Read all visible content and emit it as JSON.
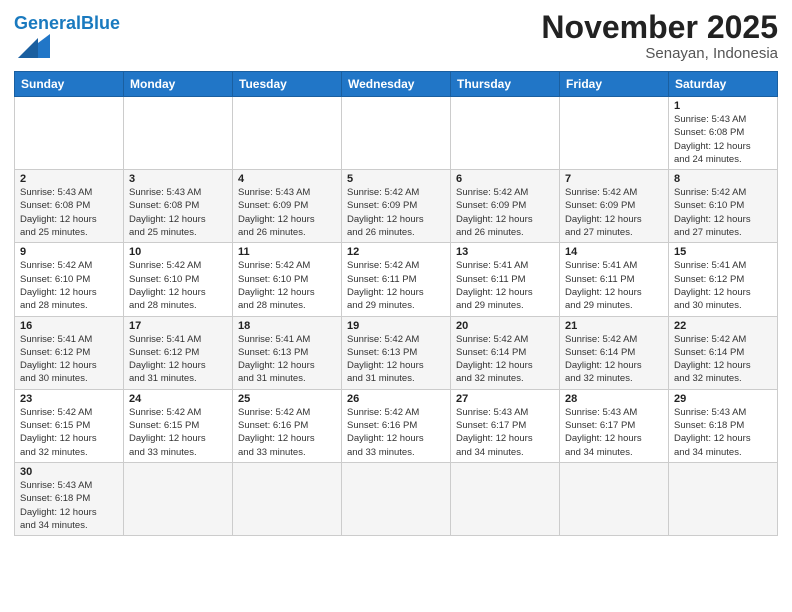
{
  "header": {
    "logo_general": "General",
    "logo_blue": "Blue",
    "month_title": "November 2025",
    "subtitle": "Senayan, Indonesia"
  },
  "weekdays": [
    "Sunday",
    "Monday",
    "Tuesday",
    "Wednesday",
    "Thursday",
    "Friday",
    "Saturday"
  ],
  "weeks": [
    [
      {
        "day": "",
        "info": ""
      },
      {
        "day": "",
        "info": ""
      },
      {
        "day": "",
        "info": ""
      },
      {
        "day": "",
        "info": ""
      },
      {
        "day": "",
        "info": ""
      },
      {
        "day": "",
        "info": ""
      },
      {
        "day": "1",
        "info": "Sunrise: 5:43 AM\nSunset: 6:08 PM\nDaylight: 12 hours\nand 24 minutes."
      }
    ],
    [
      {
        "day": "2",
        "info": "Sunrise: 5:43 AM\nSunset: 6:08 PM\nDaylight: 12 hours\nand 25 minutes."
      },
      {
        "day": "3",
        "info": "Sunrise: 5:43 AM\nSunset: 6:08 PM\nDaylight: 12 hours\nand 25 minutes."
      },
      {
        "day": "4",
        "info": "Sunrise: 5:43 AM\nSunset: 6:09 PM\nDaylight: 12 hours\nand 26 minutes."
      },
      {
        "day": "5",
        "info": "Sunrise: 5:42 AM\nSunset: 6:09 PM\nDaylight: 12 hours\nand 26 minutes."
      },
      {
        "day": "6",
        "info": "Sunrise: 5:42 AM\nSunset: 6:09 PM\nDaylight: 12 hours\nand 26 minutes."
      },
      {
        "day": "7",
        "info": "Sunrise: 5:42 AM\nSunset: 6:09 PM\nDaylight: 12 hours\nand 27 minutes."
      },
      {
        "day": "8",
        "info": "Sunrise: 5:42 AM\nSunset: 6:10 PM\nDaylight: 12 hours\nand 27 minutes."
      }
    ],
    [
      {
        "day": "9",
        "info": "Sunrise: 5:42 AM\nSunset: 6:10 PM\nDaylight: 12 hours\nand 28 minutes."
      },
      {
        "day": "10",
        "info": "Sunrise: 5:42 AM\nSunset: 6:10 PM\nDaylight: 12 hours\nand 28 minutes."
      },
      {
        "day": "11",
        "info": "Sunrise: 5:42 AM\nSunset: 6:10 PM\nDaylight: 12 hours\nand 28 minutes."
      },
      {
        "day": "12",
        "info": "Sunrise: 5:42 AM\nSunset: 6:11 PM\nDaylight: 12 hours\nand 29 minutes."
      },
      {
        "day": "13",
        "info": "Sunrise: 5:41 AM\nSunset: 6:11 PM\nDaylight: 12 hours\nand 29 minutes."
      },
      {
        "day": "14",
        "info": "Sunrise: 5:41 AM\nSunset: 6:11 PM\nDaylight: 12 hours\nand 29 minutes."
      },
      {
        "day": "15",
        "info": "Sunrise: 5:41 AM\nSunset: 6:12 PM\nDaylight: 12 hours\nand 30 minutes."
      }
    ],
    [
      {
        "day": "16",
        "info": "Sunrise: 5:41 AM\nSunset: 6:12 PM\nDaylight: 12 hours\nand 30 minutes."
      },
      {
        "day": "17",
        "info": "Sunrise: 5:41 AM\nSunset: 6:12 PM\nDaylight: 12 hours\nand 31 minutes."
      },
      {
        "day": "18",
        "info": "Sunrise: 5:41 AM\nSunset: 6:13 PM\nDaylight: 12 hours\nand 31 minutes."
      },
      {
        "day": "19",
        "info": "Sunrise: 5:42 AM\nSunset: 6:13 PM\nDaylight: 12 hours\nand 31 minutes."
      },
      {
        "day": "20",
        "info": "Sunrise: 5:42 AM\nSunset: 6:14 PM\nDaylight: 12 hours\nand 32 minutes."
      },
      {
        "day": "21",
        "info": "Sunrise: 5:42 AM\nSunset: 6:14 PM\nDaylight: 12 hours\nand 32 minutes."
      },
      {
        "day": "22",
        "info": "Sunrise: 5:42 AM\nSunset: 6:14 PM\nDaylight: 12 hours\nand 32 minutes."
      }
    ],
    [
      {
        "day": "23",
        "info": "Sunrise: 5:42 AM\nSunset: 6:15 PM\nDaylight: 12 hours\nand 32 minutes."
      },
      {
        "day": "24",
        "info": "Sunrise: 5:42 AM\nSunset: 6:15 PM\nDaylight: 12 hours\nand 33 minutes."
      },
      {
        "day": "25",
        "info": "Sunrise: 5:42 AM\nSunset: 6:16 PM\nDaylight: 12 hours\nand 33 minutes."
      },
      {
        "day": "26",
        "info": "Sunrise: 5:42 AM\nSunset: 6:16 PM\nDaylight: 12 hours\nand 33 minutes."
      },
      {
        "day": "27",
        "info": "Sunrise: 5:43 AM\nSunset: 6:17 PM\nDaylight: 12 hours\nand 34 minutes."
      },
      {
        "day": "28",
        "info": "Sunrise: 5:43 AM\nSunset: 6:17 PM\nDaylight: 12 hours\nand 34 minutes."
      },
      {
        "day": "29",
        "info": "Sunrise: 5:43 AM\nSunset: 6:18 PM\nDaylight: 12 hours\nand 34 minutes."
      }
    ],
    [
      {
        "day": "30",
        "info": "Sunrise: 5:43 AM\nSunset: 6:18 PM\nDaylight: 12 hours\nand 34 minutes."
      },
      {
        "day": "",
        "info": ""
      },
      {
        "day": "",
        "info": ""
      },
      {
        "day": "",
        "info": ""
      },
      {
        "day": "",
        "info": ""
      },
      {
        "day": "",
        "info": ""
      },
      {
        "day": "",
        "info": ""
      }
    ]
  ]
}
